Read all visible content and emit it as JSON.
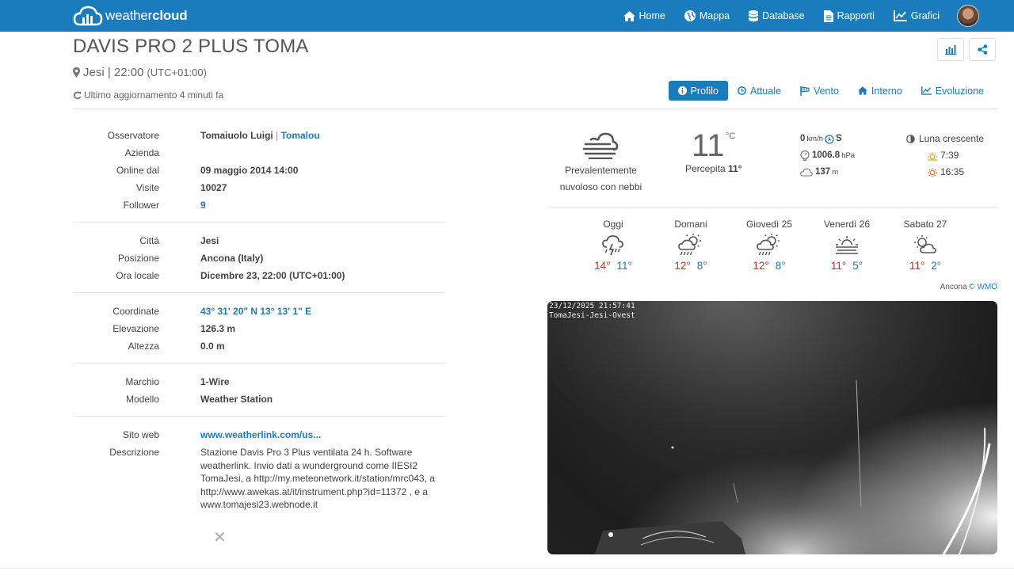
{
  "navbar": {
    "brand_light": "weather",
    "brand_bold": "cloud",
    "items": [
      {
        "label": "Home",
        "icon": "home-icon"
      },
      {
        "label": "Mappa",
        "icon": "globe-icon"
      },
      {
        "label": "Database",
        "icon": "database-icon"
      },
      {
        "label": "Rapporti",
        "icon": "document-icon"
      },
      {
        "label": "Grafici",
        "icon": "line-chart-icon"
      }
    ]
  },
  "header": {
    "title": "DAVIS PRO 2 PLUS TOMA",
    "location": "Jesi | 22:00",
    "utc": "(UTC+01:00)",
    "updated": "Ultimo aggiornamento 4 minuti fa"
  },
  "tabs": [
    "Profilo",
    "Attuale",
    "Vento",
    "Interno",
    "Evoluzione"
  ],
  "info": {
    "observer_label": "Osservatore",
    "observer_name": "Tomaiuolo Luigi",
    "observer_sep": " | ",
    "observer_user": "Tomalou",
    "company_label": "Azienda",
    "online_label": "Online dal",
    "online_val": "09 maggio 2014 14:00",
    "visits_label": "Visite",
    "visits_val": "10027",
    "followers_label": "Follower",
    "followers_val": "9",
    "city_label": "Città",
    "city_val": "Jesi",
    "position_label": "Posizione",
    "position_val": "Ancona (Italy)",
    "localtime_label": "Ora locale",
    "localtime_val": "Dicembre 23, 22:00 (UTC+01:00)",
    "coords_label": "Coordinate",
    "coords_val": "43° 31' 20\" N  13° 13' 1\" E",
    "elevation_label": "Elevazione",
    "elevation_val": "126.3 m",
    "height_label": "Altezza",
    "height_val": "0.0 m",
    "brand_label": "Marchio",
    "brand_val": "1-Wire",
    "model_label": "Modello",
    "model_val": "Weather Station",
    "website_label": "Sito web",
    "website_val": "www.weatherlink.com/us...",
    "desc_label": "Descrizione",
    "desc_val": "Stazione Davis Pro 3 Plus ventilata 24 h. Software weatherlink. Invio dati a wunderground come IIESI2 TomaJesi, a http://my.meteonetwork.it/station/mrc043, a http://www.awekas.at/it/instrument.php?id=11372 , e a www.tomajesi23.webnode.it"
  },
  "current": {
    "condition_line1": "Prevalentemente",
    "condition_line2": "nuvoloso con nebbi",
    "temp": "11",
    "temp_unit": "°C",
    "feels_label": "Percepita",
    "feels_val": "11°",
    "wind_val": "0",
    "wind_unit": "km/h",
    "wind_dir": "S",
    "pressure_val": "1006.8",
    "pressure_unit": "hPa",
    "cloud_val": "137",
    "cloud_unit": "m",
    "moon": "Luna crescente",
    "sunrise": "7:39",
    "sunset": "16:35"
  },
  "forecast": [
    {
      "day": "Oggi",
      "max": "14°",
      "min": "11°",
      "icon": "thunderstorm-rain-icon"
    },
    {
      "day": "Domani",
      "max": "12°",
      "min": "8°",
      "icon": "sun-cloud-rain-icon"
    },
    {
      "day": "Giovedì 25",
      "max": "12°",
      "min": "8°",
      "icon": "sun-cloud-rain-icon"
    },
    {
      "day": "Venerdì 26",
      "max": "11°",
      "min": "5°",
      "icon": "sun-fog-icon"
    },
    {
      "day": "Sabato 27",
      "max": "11°",
      "min": "2°",
      "icon": "partly-cloudy-night-icon"
    }
  ],
  "wmo": {
    "city": "Ancona",
    "copyright": "©",
    "link": "WMO"
  },
  "webcam": {
    "timestamp": "23/12/2025 21:57:41",
    "name": "TomaJesi-Jesi-Ovest"
  },
  "colors": {
    "primary": "#1a7bbd",
    "max_temp": "#d0301e",
    "min_temp": "#1a7bbd",
    "navbar": "#1a7bbd"
  }
}
